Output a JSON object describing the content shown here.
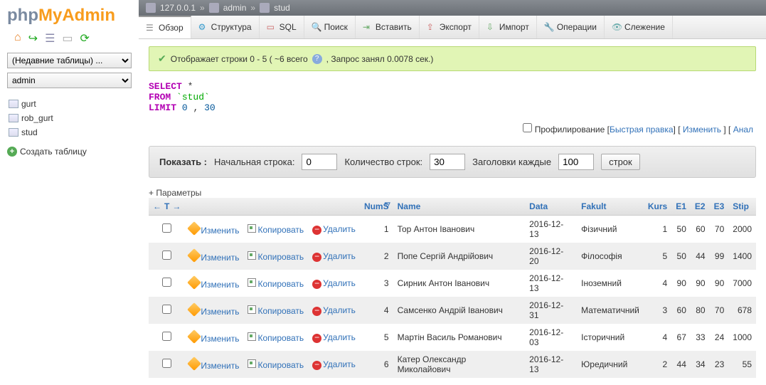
{
  "logo": {
    "p1": "php",
    "p2": "MyAdmin"
  },
  "sidebar": {
    "recent_select": "(Недавние таблицы) ...",
    "db_select": "admin",
    "tables": [
      "gurt",
      "rob_gurt",
      "stud"
    ],
    "create_label": "Создать таблицу"
  },
  "breadcrumb": {
    "server": "127.0.0.1",
    "db": "admin",
    "table": "stud"
  },
  "tabs": [
    "Обзор",
    "Структура",
    "SQL",
    "Поиск",
    "Вставить",
    "Экспорт",
    "Импорт",
    "Операции",
    "Слежение"
  ],
  "tab_active": 0,
  "notice": {
    "text": "Отображает строки 0 - 5 ( ~6 всего",
    "text2": ", Запрос занял 0.0078 сек.)"
  },
  "sql": {
    "select": "SELECT",
    "star": "*",
    "from": "FROM",
    "table": "`stud`",
    "limit": "LIMIT",
    "n1": "0",
    "n2": "30",
    "comma": ","
  },
  "profile": {
    "label": "Профилирование",
    "quick": "Быстрая правка",
    "edit": "Изменить",
    "anal": "Анал"
  },
  "controls": {
    "show": "Показать :",
    "start_label": "Начальная строка:",
    "start_val": "0",
    "count_label": "Количество строк:",
    "count_val": "30",
    "head_label": "Заголовки каждые",
    "head_val": "100",
    "rows": "строк"
  },
  "params": "+ Параметры",
  "columns": [
    "",
    "",
    "",
    "",
    "NumS",
    "Name",
    "Data",
    "Fakult",
    "Kurs",
    "E1",
    "E2",
    "E3",
    "Stip"
  ],
  "actions": {
    "edit": "Изменить",
    "copy": "Копировать",
    "del": "Удалить"
  },
  "rows": [
    {
      "n": 1,
      "name": "Тор Антон Іванович",
      "data": "2016-12-13",
      "fak": "Фізичний",
      "kurs": 1,
      "e1": 50,
      "e2": 60,
      "e3": 70,
      "stip": 2000
    },
    {
      "n": 2,
      "name": "Попе Сергій Андрійович",
      "data": "2016-12-20",
      "fak": "Філософія",
      "kurs": 5,
      "e1": 50,
      "e2": 44,
      "e3": 99,
      "stip": 1400
    },
    {
      "n": 3,
      "name": "Сирник Антон Іванович",
      "data": "2016-12-13",
      "fak": "Іноземний",
      "kurs": 4,
      "e1": 90,
      "e2": 90,
      "e3": 90,
      "stip": 7000
    },
    {
      "n": 4,
      "name": "Самсенко Андрій Іванович",
      "data": "2016-12-31",
      "fak": "Математичний",
      "kurs": 3,
      "e1": 60,
      "e2": 80,
      "e3": 70,
      "stip": 678
    },
    {
      "n": 5,
      "name": "Мартін Василь Романович",
      "data": "2016-12-03",
      "fak": "Історичний",
      "kurs": 4,
      "e1": 67,
      "e2": 33,
      "e3": 24,
      "stip": 1000
    },
    {
      "n": 6,
      "name": "Катер Олександр Миколайович",
      "data": "2016-12-13",
      "fak": "Юредичний",
      "kurs": 2,
      "e1": 44,
      "e2": 34,
      "e3": 23,
      "stip": 55
    }
  ]
}
